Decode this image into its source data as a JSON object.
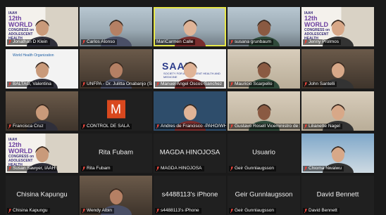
{
  "participants": [
    {
      "name": "Jonathan D Klein",
      "muted": true,
      "speaking": false,
      "scene": "banner"
    },
    {
      "name": "Carlos Alonso",
      "muted": true,
      "speaking": false,
      "scene": "office"
    },
    {
      "name": "MariCarmen Calle",
      "muted": false,
      "speaking": true,
      "scene": "office"
    },
    {
      "name": "susana grunbaum",
      "muted": true,
      "speaking": false,
      "scene": "office"
    },
    {
      "name": "Jenny Prolmos",
      "muted": true,
      "speaking": false,
      "scene": "banner"
    },
    {
      "name": "BALTAG, Valentina",
      "muted": true,
      "speaking": false,
      "scene": "who"
    },
    {
      "name": "UNFPA - Dr. Julitta Onabanjo (Sh...",
      "muted": true,
      "speaking": false,
      "scene": "room"
    },
    {
      "name": "Manuel Angel Oscos-Sanchez",
      "muted": true,
      "speaking": false,
      "scene": "saam"
    },
    {
      "name": "Mauricio Scarpello",
      "muted": true,
      "speaking": false,
      "scene": "wall"
    },
    {
      "name": "John Santelli",
      "muted": true,
      "speaking": false,
      "scene": "room"
    },
    {
      "name": "Francisca Cruz",
      "muted": true,
      "speaking": false,
      "scene": "room"
    },
    {
      "name": "CONTROL DE SALA",
      "muted": true,
      "speaking": false,
      "scene": "mlogo"
    },
    {
      "name": "Andres de Francisco -PAHO/WHO",
      "muted": true,
      "speaking": false,
      "scene": "blue"
    },
    {
      "name": "Gustavo Rosell Viceministro de S...",
      "muted": true,
      "speaking": false,
      "scene": "wall"
    },
    {
      "name": "Lilianette Nagel",
      "muted": true,
      "speaking": false,
      "scene": "wall"
    },
    {
      "name": "Susan Sawyer, IAAH",
      "muted": true,
      "speaking": false,
      "scene": "banner"
    },
    {
      "name": "Rita Fubam",
      "muted": true,
      "speaking": false,
      "scene": "nameonly"
    },
    {
      "name": "MAGDA HINOJOSA",
      "muted": true,
      "speaking": false,
      "scene": "nameonly"
    },
    {
      "name": "Geir Gunnlaugsson",
      "muted": true,
      "speaking": false,
      "scene": "nameonly",
      "center": "Usuario"
    },
    {
      "name": "Chioma Nwaiwu",
      "muted": true,
      "speaking": false,
      "scene": "sky"
    },
    {
      "name": "Chisina Kapungu",
      "muted": true,
      "speaking": false,
      "scene": "nameonly"
    },
    {
      "name": "Wendy Albin",
      "muted": true,
      "speaking": false,
      "scene": "room"
    },
    {
      "name": "s4488113's iPhone",
      "muted": true,
      "speaking": false,
      "scene": "nameonly"
    },
    {
      "name": "Geir Gunnlaugsson",
      "muted": true,
      "speaking": false,
      "scene": "nameonly"
    },
    {
      "name": "David Bennett",
      "muted": true,
      "speaking": false,
      "scene": "nameonly"
    }
  ],
  "banner": {
    "line1": "IAAH",
    "line2": "12th WORLD",
    "line3": "CONGRESS on",
    "line4": "ADOLESCENT HEALTH"
  },
  "who_text": "World Health Organization",
  "saam_text": "SAAM",
  "saam_sub": "SOCIETY FOR ADOLESCENT HEALTH AND MEDICINE",
  "control_logo": "M",
  "colors": {
    "speaking_border": "#e7e74a",
    "muted_red": "#e0433a",
    "tile_bg": "#2b2b2b",
    "page_bg": "#1a1a1a"
  }
}
